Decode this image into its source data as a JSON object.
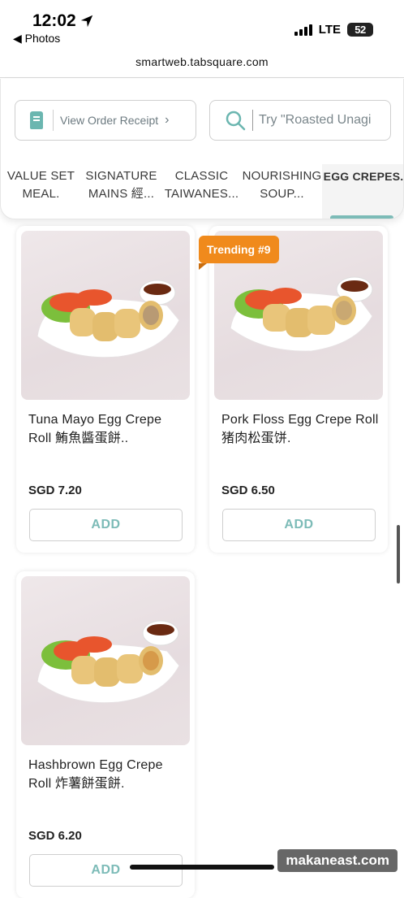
{
  "status_bar": {
    "time": "12:02",
    "back_label": "◀ Photos",
    "network": "LTE",
    "battery": "52"
  },
  "browser": {
    "url": "smartweb.tabsquare.com"
  },
  "header": {
    "receipt_label": "View Order Receipt",
    "search_placeholder": "Try \"Roasted Unagi"
  },
  "tabs": [
    {
      "label": "VALUE SET MEAL."
    },
    {
      "label": "SIGNATURE MAINS 經..."
    },
    {
      "label": "CLASSIC TAIWANES..."
    },
    {
      "label": "NOURISHING SOUP..."
    },
    {
      "label": "EGG CREPES."
    }
  ],
  "active_tab": "EGG CREPES.",
  "products": [
    {
      "name": "Tuna Mayo Egg Crepe Roll 鮪魚醬蛋餅..",
      "price": "SGD 7.20",
      "add_label": "ADD"
    },
    {
      "name": "Pork Floss Egg Crepe Roll 猪肉松蛋饼.",
      "price": "SGD 6.50",
      "add_label": "ADD",
      "badge": "Trending #9"
    },
    {
      "name": "Hashbrown Egg Crepe Roll 炸薯餅蛋餅.",
      "price": "SGD 6.20",
      "add_label": "ADD"
    }
  ],
  "watermark": "makaneast.com",
  "colors": {
    "accent": "#7cbbb7",
    "badge": "#f08a1c"
  }
}
